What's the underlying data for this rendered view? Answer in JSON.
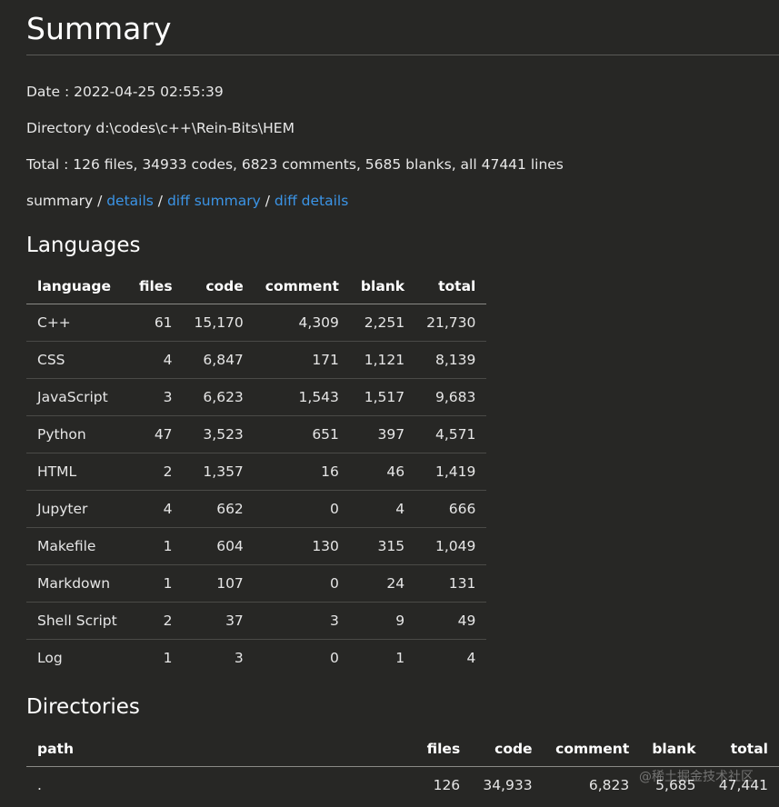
{
  "title": "Summary",
  "meta": {
    "date": "Date : 2022-04-25 02:55:39",
    "directory": "Directory d:\\codes\\c++\\Rein-Bits\\HEM",
    "total": "Total : 126 files, 34933 codes, 6823 comments, 5685 blanks, all 47441 lines"
  },
  "nav": {
    "summary": "summary",
    "sep1": " / ",
    "details": "details",
    "sep2": " / ",
    "diff_summary": "diff summary",
    "sep3": " / ",
    "diff_details": "diff details"
  },
  "languages": {
    "heading": "Languages",
    "columns": [
      "language",
      "files",
      "code",
      "comment",
      "blank",
      "total"
    ],
    "rows": [
      [
        "C++",
        "61",
        "15,170",
        "4,309",
        "2,251",
        "21,730"
      ],
      [
        "CSS",
        "4",
        "6,847",
        "171",
        "1,121",
        "8,139"
      ],
      [
        "JavaScript",
        "3",
        "6,623",
        "1,543",
        "1,517",
        "9,683"
      ],
      [
        "Python",
        "47",
        "3,523",
        "651",
        "397",
        "4,571"
      ],
      [
        "HTML",
        "2",
        "1,357",
        "16",
        "46",
        "1,419"
      ],
      [
        "Jupyter",
        "4",
        "662",
        "0",
        "4",
        "666"
      ],
      [
        "Makefile",
        "1",
        "604",
        "130",
        "315",
        "1,049"
      ],
      [
        "Markdown",
        "1",
        "107",
        "0",
        "24",
        "131"
      ],
      [
        "Shell Script",
        "2",
        "37",
        "3",
        "9",
        "49"
      ],
      [
        "Log",
        "1",
        "3",
        "0",
        "1",
        "4"
      ]
    ]
  },
  "directories": {
    "heading": "Directories",
    "columns": [
      "path",
      "files",
      "code",
      "comment",
      "blank",
      "total"
    ],
    "rows": [
      [
        ".",
        "126",
        "34,933",
        "6,823",
        "5,685",
        "47,441"
      ]
    ]
  },
  "watermark": "@稀土掘金技术社区",
  "colors": {
    "background": "#272725",
    "link": "#3b94e6"
  }
}
